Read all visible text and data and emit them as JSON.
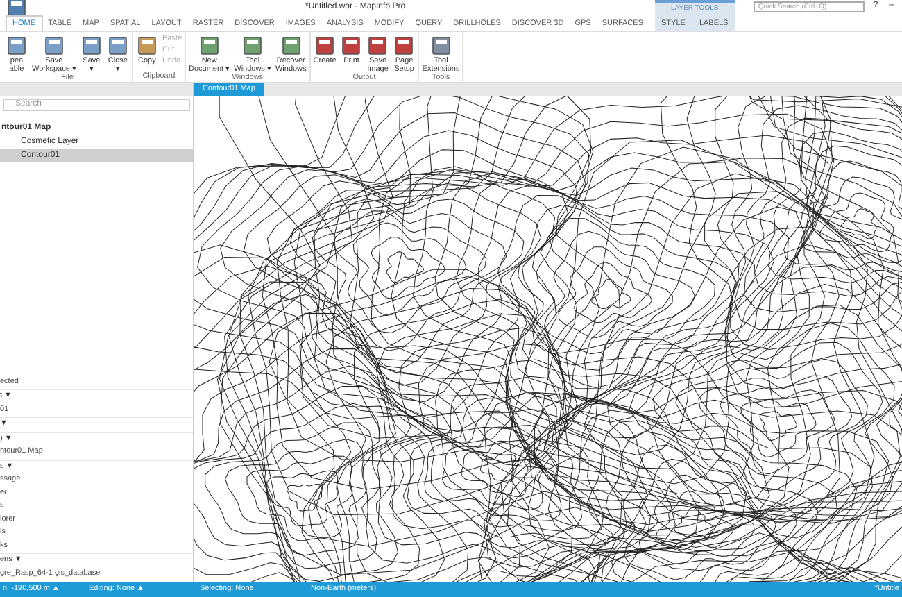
{
  "window": {
    "title": "*Untitled.wor - MapInfo Pro"
  },
  "quick_search": {
    "placeholder": "Quick Search (Ctrl+Q)"
  },
  "window_controls": [
    "?",
    "–"
  ],
  "contextual_group": {
    "title": "LAYER TOOLS"
  },
  "tabs": [
    {
      "label": "HOME",
      "selected": true,
      "contextual": false
    },
    {
      "label": "TABLE",
      "selected": false,
      "contextual": false
    },
    {
      "label": "MAP",
      "selected": false,
      "contextual": false
    },
    {
      "label": "SPATIAL",
      "selected": false,
      "contextual": false
    },
    {
      "label": "LAYOUT",
      "selected": false,
      "contextual": false
    },
    {
      "label": "RASTER",
      "selected": false,
      "contextual": false
    },
    {
      "label": "DISCOVER",
      "selected": false,
      "contextual": false
    },
    {
      "label": "IMAGES",
      "selected": false,
      "contextual": false
    },
    {
      "label": "ANALYSIS",
      "selected": false,
      "contextual": false
    },
    {
      "label": "MODIFY",
      "selected": false,
      "contextual": false
    },
    {
      "label": "QUERY",
      "selected": false,
      "contextual": false
    },
    {
      "label": "DRILLHOLES",
      "selected": false,
      "contextual": false
    },
    {
      "label": "DISCOVER 3D",
      "selected": false,
      "contextual": false
    },
    {
      "label": "GPS",
      "selected": false,
      "contextual": false
    },
    {
      "label": "SURFACES",
      "selected": false,
      "contextual": false
    },
    {
      "label": "STYLE",
      "selected": false,
      "contextual": true
    },
    {
      "label": "LABELS",
      "selected": false,
      "contextual": true
    }
  ],
  "ribbon_groups": [
    {
      "title": "File",
      "buttons": [
        {
          "kind": "large",
          "label": "pen\nable",
          "disabled": false
        },
        {
          "kind": "large",
          "label": "Save\nWorkspace ▾",
          "disabled": false
        },
        {
          "kind": "large",
          "label": "Save\n▾",
          "disabled": false
        },
        {
          "kind": "large",
          "label": "Close\n▾",
          "disabled": false
        }
      ]
    },
    {
      "title": "Clipboard",
      "buttons": [
        {
          "kind": "large",
          "label": "Copy",
          "disabled": false
        },
        {
          "kind": "small",
          "label": "Paste",
          "disabled": true
        },
        {
          "kind": "small",
          "label": "Cut",
          "disabled": true
        },
        {
          "kind": "small",
          "label": "Undo",
          "disabled": true
        }
      ]
    },
    {
      "title": "Windows",
      "buttons": [
        {
          "kind": "large",
          "label": "New\nDocument ▾",
          "disabled": false
        },
        {
          "kind": "large",
          "label": "Tool\nWindows ▾",
          "disabled": false
        },
        {
          "kind": "large",
          "label": "Recover\nWindows",
          "disabled": false
        }
      ]
    },
    {
      "title": "Output",
      "buttons": [
        {
          "kind": "large",
          "label": "Create",
          "disabled": false
        },
        {
          "kind": "large",
          "label": "Print",
          "disabled": false
        },
        {
          "kind": "large",
          "label": "Save\nImage",
          "disabled": false
        },
        {
          "kind": "large",
          "label": "Page\nSetup",
          "disabled": false
        }
      ]
    },
    {
      "title": "Tools",
      "buttons": [
        {
          "kind": "large",
          "label": "Tool\nExtensions",
          "disabled": false
        }
      ]
    }
  ],
  "explorer": {
    "search": {
      "placeholder": "Search"
    },
    "map_name": "ntour01 Map",
    "layers": [
      {
        "name": "Cosmetic Layer",
        "selected": false
      },
      {
        "name": "Contour01",
        "selected": true
      }
    ]
  },
  "document_tab": {
    "label": "Contour01 Map"
  },
  "lower_panel": [
    {
      "kind": "item",
      "text": "ected"
    },
    {
      "kind": "header",
      "text": "t ▼"
    },
    {
      "kind": "item",
      "text": "01"
    },
    {
      "kind": "header",
      "text": "▼"
    },
    {
      "kind": "header",
      "text": ") ▼"
    },
    {
      "kind": "item",
      "text": "ntour01 Map"
    },
    {
      "kind": "header",
      "text": "s ▼"
    },
    {
      "kind": "item",
      "text": "ssage"
    },
    {
      "kind": "item",
      "text": "er"
    },
    {
      "kind": "item",
      "text": "s"
    },
    {
      "kind": "item",
      "text": "lorer"
    },
    {
      "kind": "item",
      "text": "ls"
    },
    {
      "kind": "item",
      "text": "ks"
    },
    {
      "kind": "header",
      "text": "ens ▼"
    },
    {
      "kind": "item",
      "text": "gre_Rasp_64-1 gis_database"
    }
  ],
  "status_bar": [
    "n, -190,500 m ▲",
    "Editing: None ▲",
    "Selecting: None",
    "Non-Earth (meters)",
    "*Untitle"
  ]
}
